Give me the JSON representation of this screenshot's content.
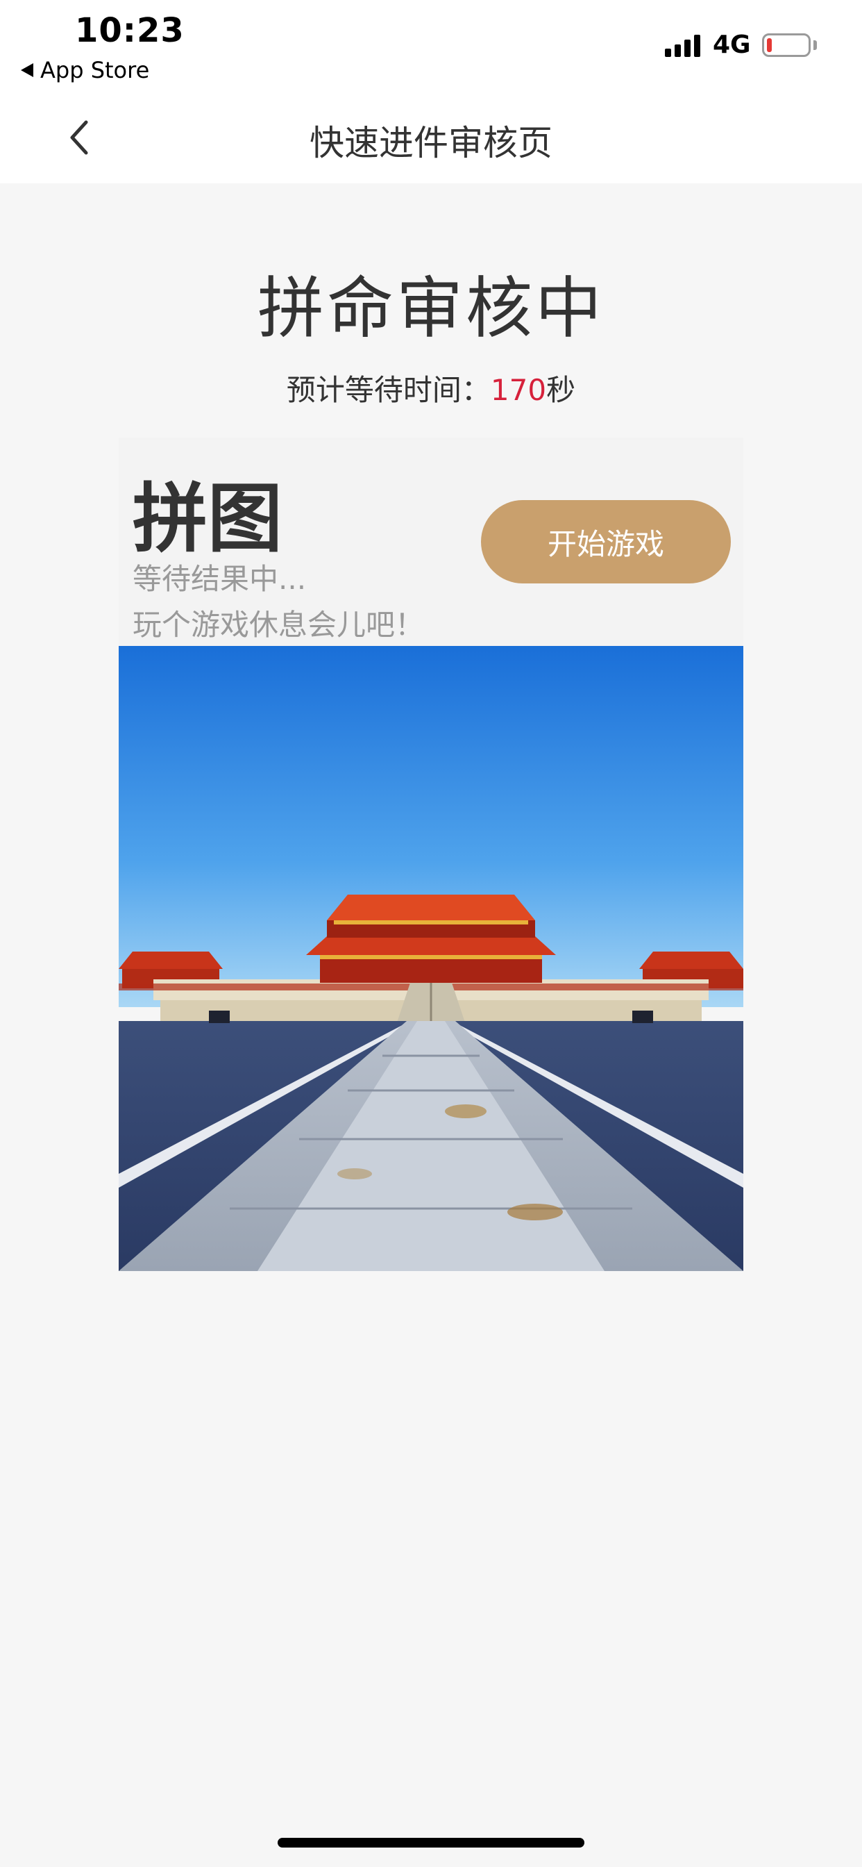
{
  "status_bar": {
    "time": "10:23",
    "back_app": "App Store",
    "network": "4G",
    "battery_level": 0.12
  },
  "nav": {
    "title": "快速进件审核页"
  },
  "main": {
    "headline": "拼命审核中",
    "wait_prefix": "预计等待时间：",
    "wait_seconds": "170",
    "wait_suffix": "秒"
  },
  "game": {
    "title": "拼图",
    "subtitle_1": "等待结果中...",
    "subtitle_2": "玩个游戏休息会儿吧！",
    "start_label": "开始游戏"
  },
  "colors": {
    "accent": "#c9a06d",
    "countdown": "#d6213b",
    "background": "#f6f6f6"
  },
  "icons": {
    "back": "chevron-left-icon",
    "back_app": "triangle-left-icon",
    "signal": "cellular-signal-icon",
    "battery": "battery-low-icon"
  }
}
